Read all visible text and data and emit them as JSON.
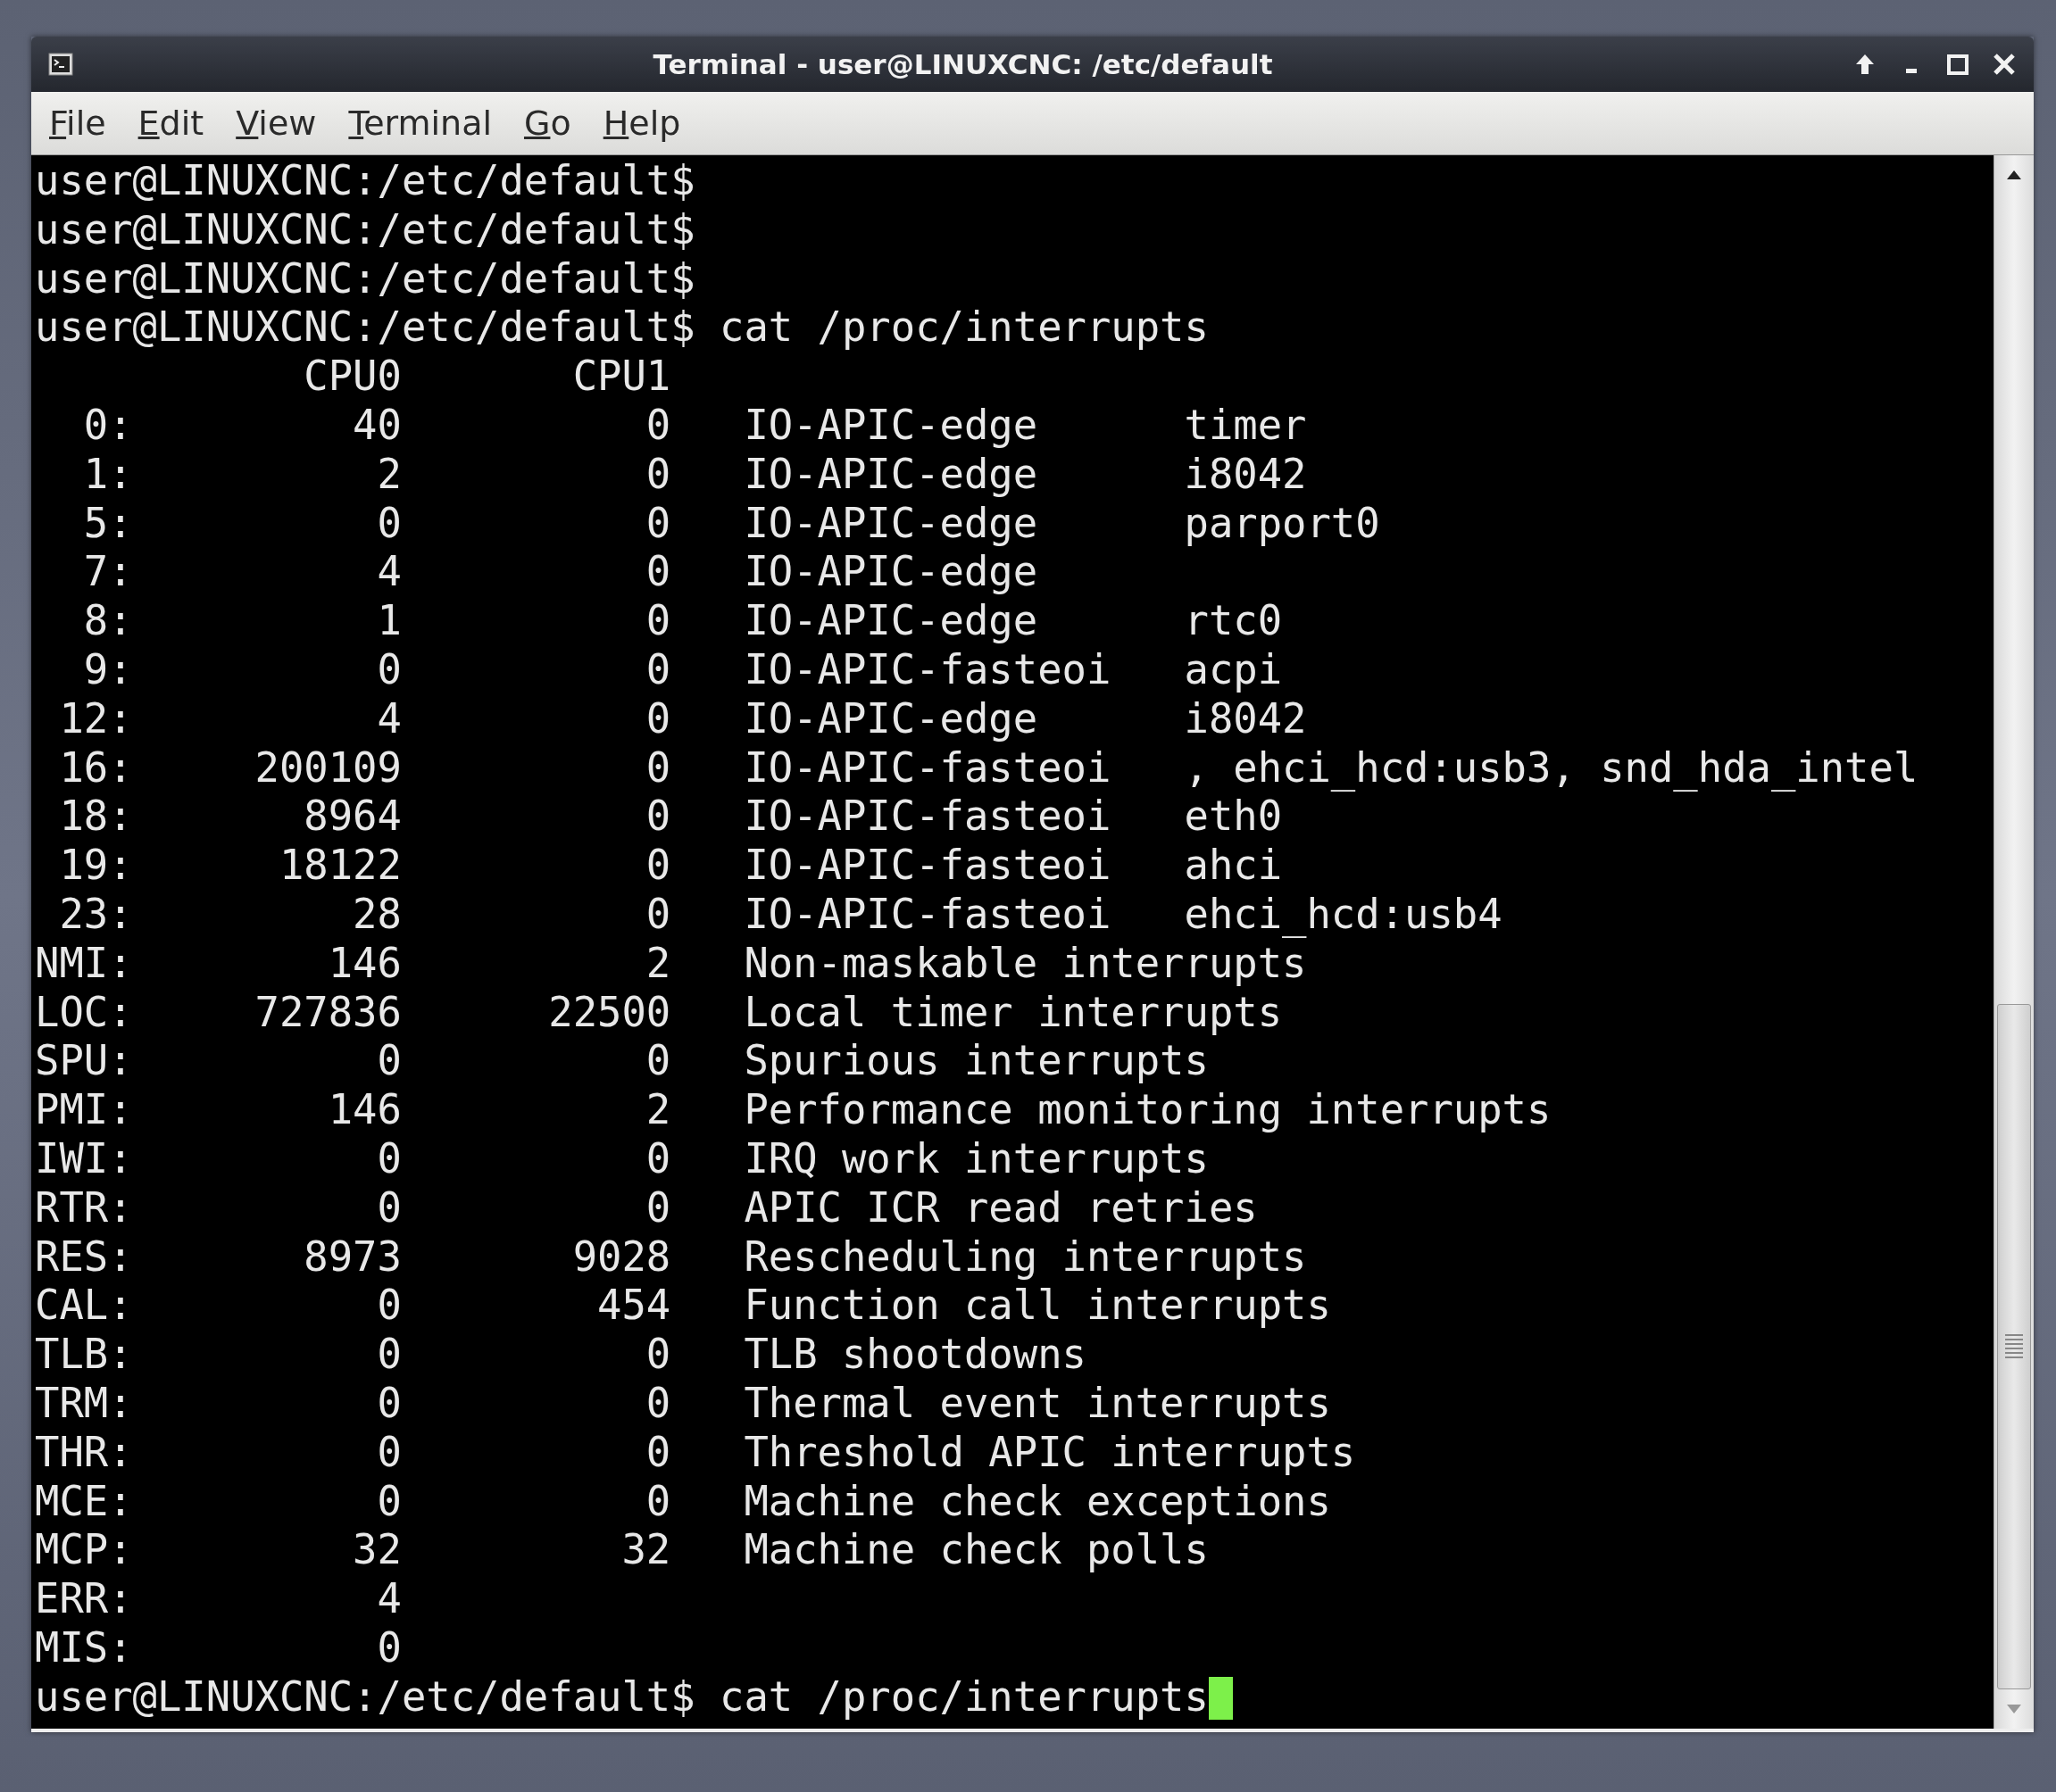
{
  "window": {
    "title": "Terminal - user@LINUXCNC: /etc/default"
  },
  "menu": [
    {
      "label": "File"
    },
    {
      "label": "Edit"
    },
    {
      "label": "View"
    },
    {
      "label": "Terminal"
    },
    {
      "label": "Go"
    },
    {
      "label": "Help"
    }
  ],
  "terminal": {
    "cursor_visible": true,
    "lines": [
      "user@LINUXCNC:/etc/default$",
      "user@LINUXCNC:/etc/default$",
      "user@LINUXCNC:/etc/default$",
      "user@LINUXCNC:/etc/default$ cat /proc/interrupts",
      "           CPU0       CPU1",
      "  0:         40          0   IO-APIC-edge      timer",
      "  1:          2          0   IO-APIC-edge      i8042",
      "  5:          0          0   IO-APIC-edge      parport0",
      "  7:          4          0   IO-APIC-edge",
      "  8:          1          0   IO-APIC-edge      rtc0",
      "  9:          0          0   IO-APIC-fasteoi   acpi",
      " 12:          4          0   IO-APIC-edge      i8042",
      " 16:     200109          0   IO-APIC-fasteoi   , ehci_hcd:usb3, snd_hda_intel",
      " 18:       8964          0   IO-APIC-fasteoi   eth0",
      " 19:      18122          0   IO-APIC-fasteoi   ahci",
      " 23:         28          0   IO-APIC-fasteoi   ehci_hcd:usb4",
      "NMI:        146          2   Non-maskable interrupts",
      "LOC:     727836      22500   Local timer interrupts",
      "SPU:          0          0   Spurious interrupts",
      "PMI:        146          2   Performance monitoring interrupts",
      "IWI:          0          0   IRQ work interrupts",
      "RTR:          0          0   APIC ICR read retries",
      "RES:       8973       9028   Rescheduling interrupts",
      "CAL:          0        454   Function call interrupts",
      "TLB:          0          0   TLB shootdowns",
      "TRM:          0          0   Thermal event interrupts",
      "THR:          0          0   Threshold APIC interrupts",
      "MCE:          0          0   Machine check exceptions",
      "MCP:         32         32   Machine check polls",
      "ERR:          4",
      "MIS:          0",
      "user@LINUXCNC:/etc/default$ cat /proc/interrupts"
    ]
  }
}
